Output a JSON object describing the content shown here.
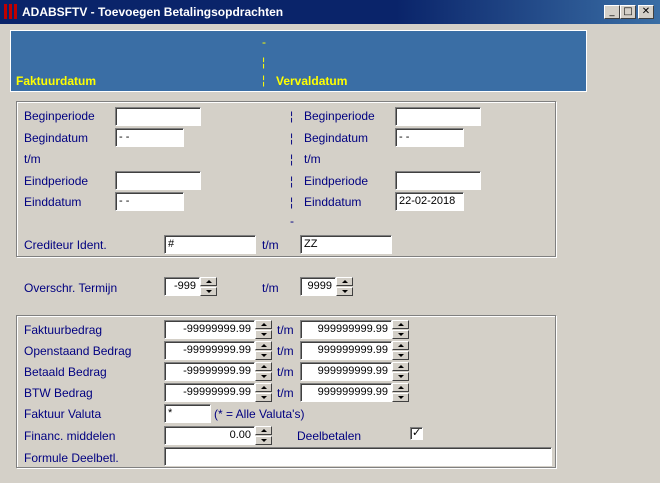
{
  "window": {
    "title": "ADABSFTV - Toevoegen Betalingsopdrachten",
    "buttons": [
      "_",
      "□",
      "✕"
    ]
  },
  "header": {
    "left_label": "Faktuurdatum",
    "right_label": "Vervaldatum",
    "divider": "¦"
  },
  "dates": {
    "separator": "¦",
    "dash": "-",
    "left": {
      "beginperiode_label": "Beginperiode",
      "beginperiode_value": "",
      "begindatum_label": "Begindatum",
      "begindatum_value": "- -",
      "tm_label": "t/m",
      "eindperiode_label": "Eindperiode",
      "eindperiode_value": "",
      "einddatum_label": "Einddatum",
      "einddatum_value": "- -"
    },
    "right": {
      "beginperiode_label": "Beginperiode",
      "beginperiode_value": "",
      "begindatum_label": "Begindatum",
      "begindatum_value": "- -",
      "tm_label": "t/m",
      "eindperiode_label": "Eindperiode",
      "eindperiode_value": "",
      "einddatum_label": "Einddatum",
      "einddatum_value": "22-02-2018"
    },
    "crediteur": {
      "label": "Crediteur Ident.",
      "from": "#",
      "tm": "t/m",
      "to": "ZZ"
    }
  },
  "termijn": {
    "label": "Overschr. Termijn",
    "from": "-999",
    "tm": "t/m",
    "to": "9999"
  },
  "amounts": {
    "tm": "t/m",
    "rows": [
      {
        "label": "Faktuurbedrag",
        "from": "-99999999.99",
        "to": "999999999.99"
      },
      {
        "label": "Openstaand Bedrag",
        "from": "-99999999.99",
        "to": "999999999.99"
      },
      {
        "label": "Betaald Bedrag",
        "from": "-99999999.99",
        "to": "999999999.99"
      },
      {
        "label": "BTW Bedrag",
        "from": "-99999999.99",
        "to": "999999999.99"
      }
    ],
    "valuta": {
      "label": "Faktuur Valuta",
      "value": "*",
      "hint": "(*  =  Alle Valuta's)"
    },
    "financ": {
      "label": "Financ. middelen",
      "value": "0.00"
    },
    "deelbetalen": {
      "label": "Deelbetalen",
      "checked": true,
      "check_glyph": "✓"
    },
    "formule": {
      "label": "Formule Deelbetl.",
      "value": ""
    }
  }
}
